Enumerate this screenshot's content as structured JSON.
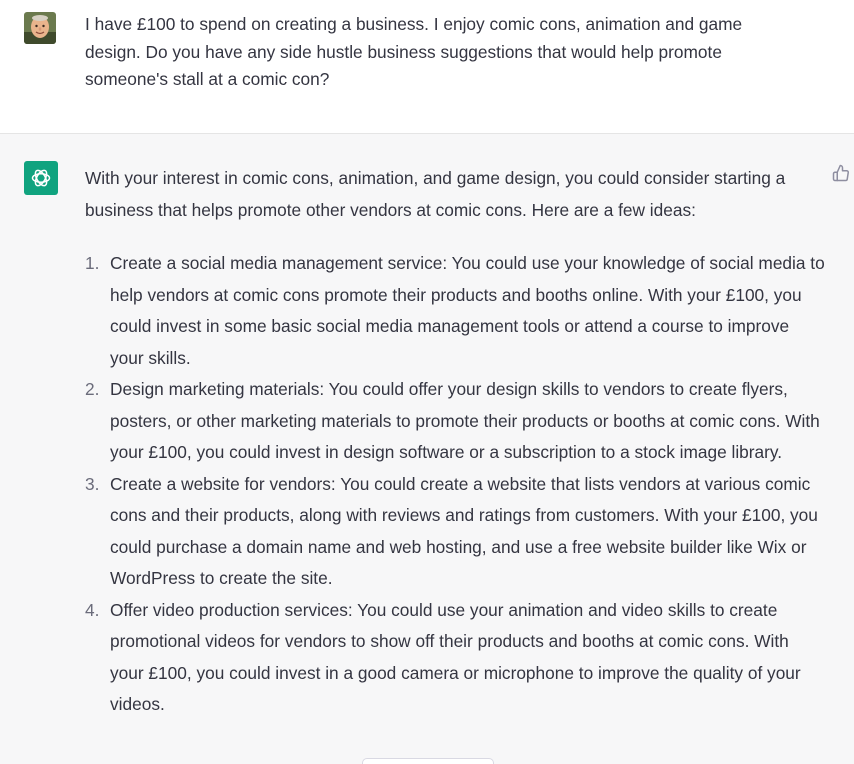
{
  "user_message": {
    "text": "I have £100 to spend on creating a business. I enjoy comic cons, animation and game design. Do you have any side hustle business suggestions that would help promote someone's stall at a comic con?"
  },
  "assistant_message": {
    "intro": "With your interest in comic cons, animation, and game design, you could consider starting a business that helps promote other vendors at comic cons. Here are a few ideas:",
    "items": [
      {
        "number": "1.",
        "text": "Create a social media management service: You could use your knowledge of social media to help vendors at comic cons promote their products and booths online. With your £100, you could invest in some basic social media management tools or attend a course to improve your skills."
      },
      {
        "number": "2.",
        "text": "Design marketing materials: You could offer your design skills to vendors to create flyers, posters, or other marketing materials to promote their products or booths at comic cons. With your £100, you could invest in design software or a subscription to a stock image library."
      },
      {
        "number": "3.",
        "text": "Create a website for vendors: You could create a website that lists vendors at various comic cons and their products, along with reviews and ratings from customers. With your £100, you could purchase a domain name and web hosting, and use a free website builder like Wix or WordPress to create the site."
      },
      {
        "number": "4.",
        "text": "Offer video production services: You could use your animation and video skills to create promotional videos for vendors to show off their products and booths at comic cons. With your £100, you could invest in a good camera or microphone to improve the quality of your videos."
      }
    ]
  },
  "icons": {
    "user_avatar": "user-avatar",
    "assistant_avatar": "openai-logo-icon",
    "feedback": "thumbs-up-icon"
  },
  "colors": {
    "assistant_bg": "#f7f7f8",
    "user_bg": "#ffffff",
    "brand_green": "#10a37f",
    "text": "#343541"
  }
}
